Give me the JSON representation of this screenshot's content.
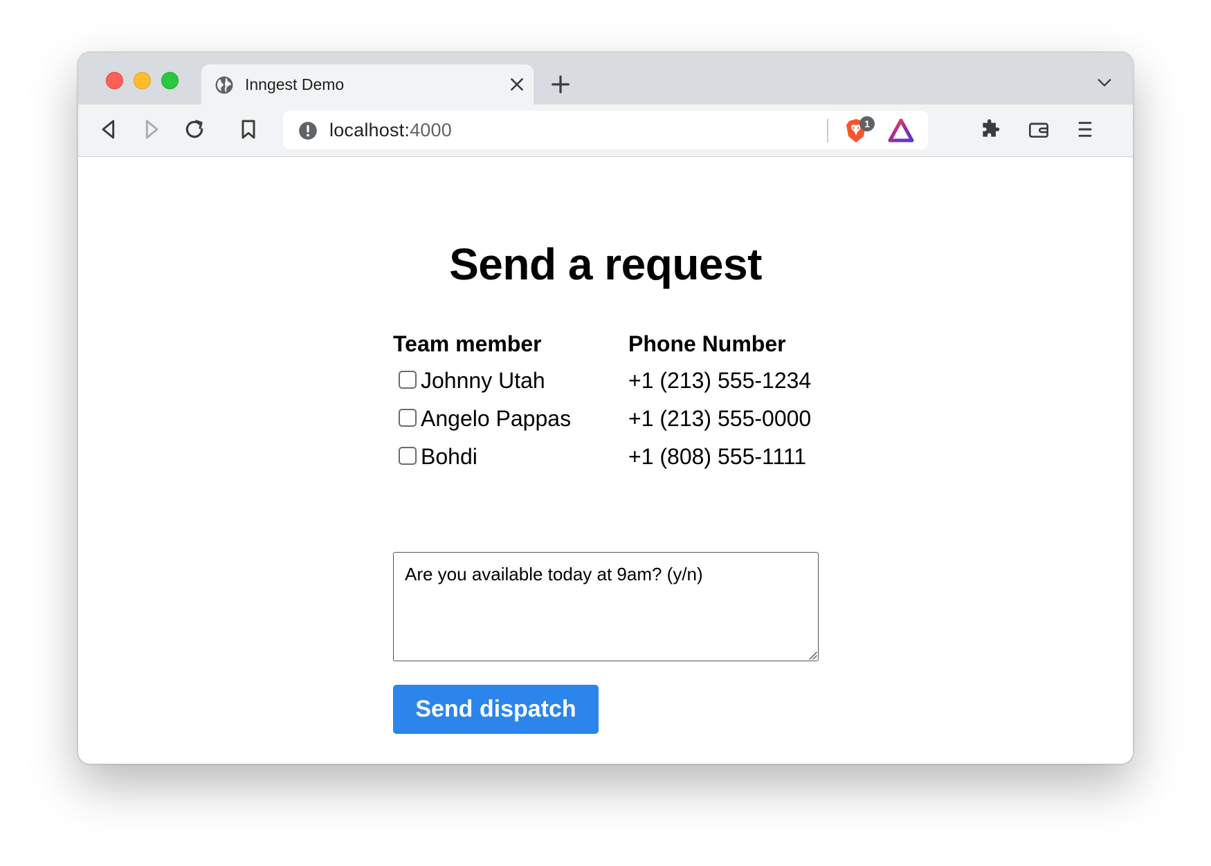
{
  "browser": {
    "tab": {
      "title": "Inngest Demo",
      "icon": "globe-icon"
    },
    "address": {
      "host": "localhost:",
      "port": "4000"
    },
    "shield_badge": "1",
    "colors": {
      "tabstrip": "#d8dbdf",
      "toolbar": "#f1f3f4",
      "brave_orange": "#fb542b"
    }
  },
  "page": {
    "heading": "Send a request",
    "columns": {
      "member": "Team member",
      "phone": "Phone Number"
    },
    "members": [
      {
        "name": "Johnny Utah",
        "phone": "+1 (213) 555-1234",
        "checked": false
      },
      {
        "name": "Angelo Pappas",
        "phone": "+1 (213) 555-0000",
        "checked": false
      },
      {
        "name": "Bohdi",
        "phone": "+1 (808) 555-1111",
        "checked": false
      }
    ],
    "message": "Are you available today at 9am? (y/n)",
    "send_label": "Send dispatch",
    "accent": "#2b85ea"
  }
}
